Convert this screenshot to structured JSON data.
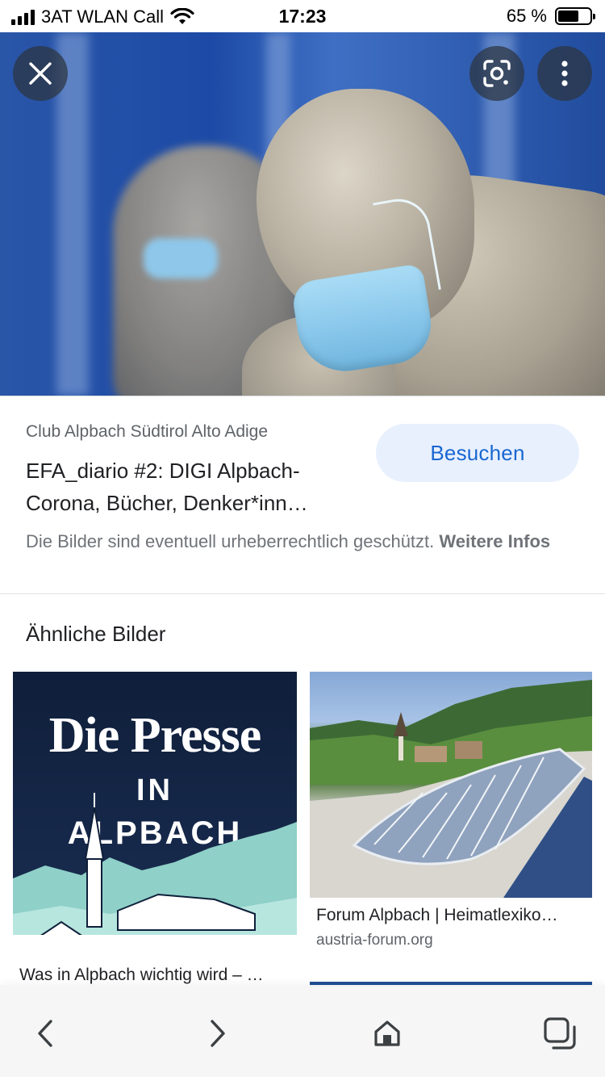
{
  "status_bar": {
    "carrier": "3AT WLAN Call",
    "time": "17:23",
    "battery_percent": "65 %",
    "battery_level": 0.65,
    "icons": [
      "signal-icon",
      "wifi-icon",
      "battery-icon"
    ]
  },
  "viewer": {
    "close_icon": "close-icon",
    "lens_icon": "lens-icon",
    "more_icon": "more-vert-icon"
  },
  "result": {
    "source": "Club Alpbach Südtirol Alto Adige",
    "title_line1": "EFA_diario #2: DIGI Alpbach-",
    "title_line2": "Corona, Bücher, Denker*inn…",
    "visit_label": "Besuchen",
    "copyright_text": "Die Bilder sind eventuell urheberrechtlich geschützt.",
    "more_info_label": "Weitere Infos"
  },
  "similar": {
    "heading": "Ähnliche Bilder",
    "items": [
      {
        "image_title": "Die Presse",
        "image_sub1": "IN",
        "image_sub2": "ALPBACH",
        "caption": "Was in Alpbach wichtig wird – …"
      },
      {
        "caption": "Forum Alpbach | Heimatlexiko…",
        "domain": "austria-forum.org"
      }
    ]
  },
  "bottom_nav": {
    "icons": [
      "back-icon",
      "forward-icon",
      "home-icon",
      "tabs-icon"
    ]
  },
  "colors": {
    "accent": "#1967d2",
    "visit_button_bg": "#e8f0fe",
    "secondary_text": "#5f6368"
  }
}
